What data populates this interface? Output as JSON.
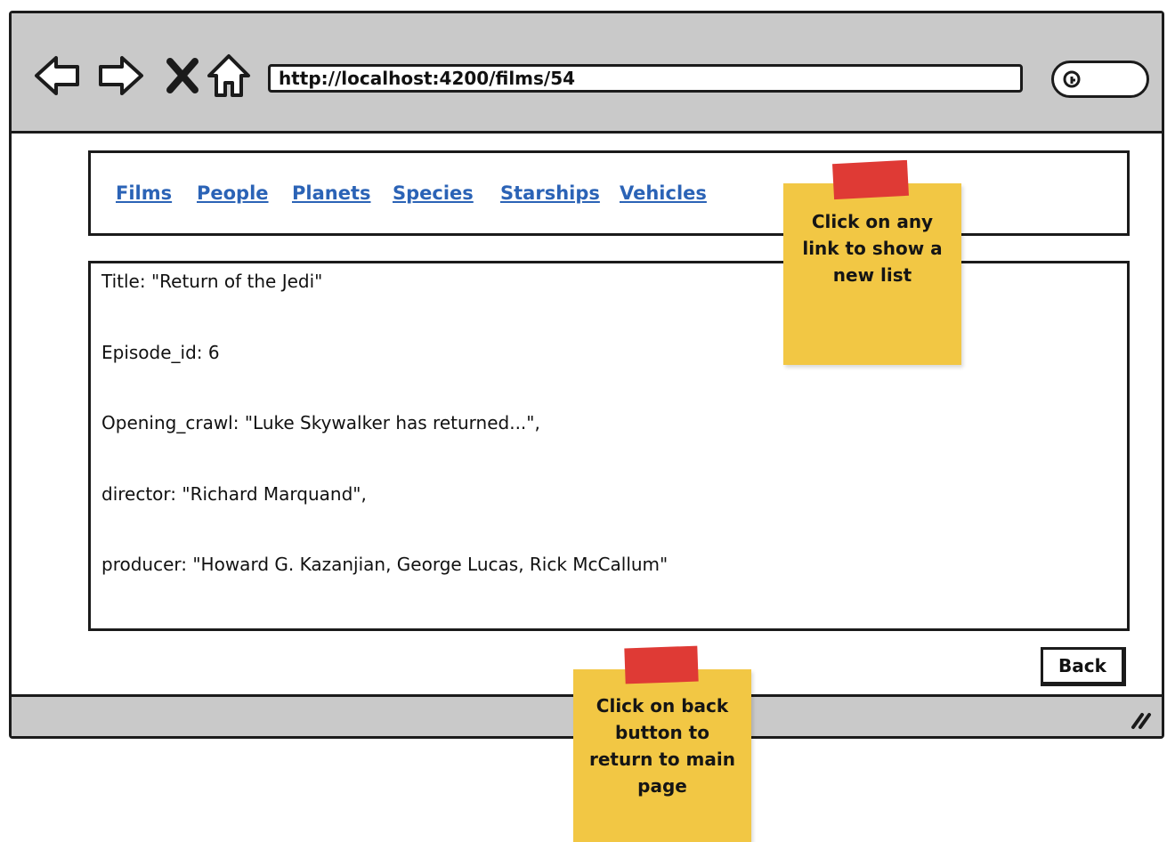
{
  "browser": {
    "url": "http://localhost:4200/films/54"
  },
  "icons": {
    "back": "back-arrow-icon",
    "forward": "forward-arrow-icon",
    "stop": "close-icon",
    "home": "home-icon",
    "search": "search-icon",
    "resize": "resize-grip-icon"
  },
  "nav": {
    "links": [
      "Films",
      "People",
      "Planets",
      "Species",
      "Starships",
      "Vehicles"
    ]
  },
  "film": {
    "title_line": "Title: \"Return of the Jedi\"",
    "episode_line": "Episode_id: 6",
    "crawl_line": "Opening_crawl: \"Luke Skywalker has returned...\",",
    "director_line": "director: \"Richard Marquand\",",
    "producer_line": "producer: \"Howard G. Kazanjian, George Lucas, Rick McCallum\""
  },
  "actions": {
    "back_label": "Back"
  },
  "notes": {
    "nav_note": "Click on any link to show a new list",
    "back_note": "Click on back button to return to main page"
  },
  "colors": {
    "toolbar": "#c9c9c9",
    "link": "#2b63b6",
    "sticky": "#f2c744",
    "tape": "#df3a35"
  }
}
